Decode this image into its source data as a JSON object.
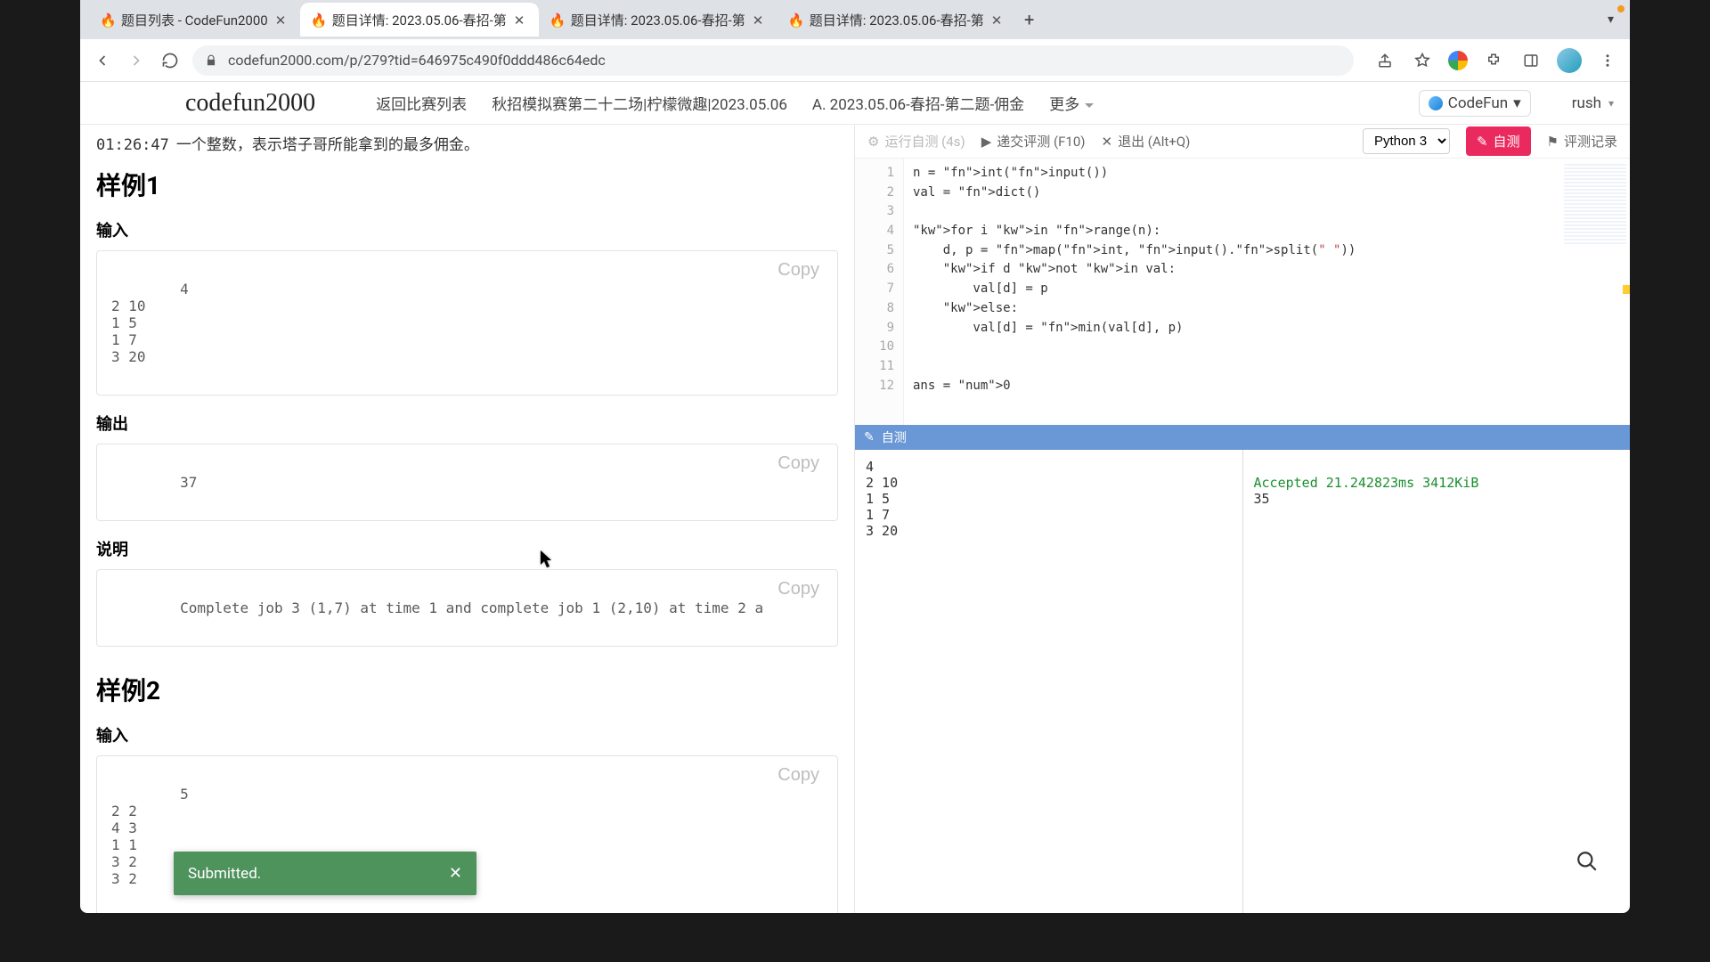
{
  "tabs": [
    {
      "title": "题目列表 - CodeFun2000",
      "active": false
    },
    {
      "title": "题目详情: 2023.05.06-春招-第",
      "active": true
    },
    {
      "title": "题目详情: 2023.05.06-春招-第",
      "active": false
    },
    {
      "title": "题目详情: 2023.05.06-春招-第",
      "active": false
    }
  ],
  "url": "codefun2000.com/p/279?tid=646975c490f0ddd486c64edc",
  "site": {
    "logo": "codefun2000",
    "nav": {
      "back": "返回比赛列表",
      "contest": "秋招模拟赛第二十二场|柠檬微趣|2023.05.06",
      "problem": "A. 2023.05.06-春招-第二题-佣金",
      "more": "更多",
      "codefun": "CodeFun",
      "user": "rush"
    }
  },
  "left": {
    "timer": "01:26:47",
    "desc_frag": "一个整数，表示塔子哥所能拿到的最多佣金。",
    "sample1": "样例1",
    "input_h": "输入",
    "output_h": "输出",
    "explain_h": "说明",
    "sample2": "样例2",
    "copy": "Copy",
    "s1_in": "4\n2 10\n1 5\n1 7\n3 20",
    "s1_out": "37",
    "s1_exp": "Complete job 3 (1,7) at time 1 and complete job 1 (2,10) at time 2 a",
    "s2_in": "5\n2 2\n4 3\n1 1\n3 2\n3 2"
  },
  "rtoolbar": {
    "selftest_run": "运行自测 (4s)",
    "submit": "递交评测 (F10)",
    "exit": "退出 (Alt+Q)",
    "lang": "Python 3",
    "btn": "自测",
    "record": "评测记录"
  },
  "code": {
    "gutter": "1\n2\n3\n4\n5\n6\n7\n8\n9\n10\n11\n12",
    "lines": [
      "n = int(input())",
      "val = dict()",
      "",
      "for i in range(n):",
      "    d, p = map(int, input().split(\" \"))",
      "    if d not in val:",
      "        val[d] = p",
      "    else:",
      "        val[d] = min(val[d], p)",
      "",
      "",
      "ans = 0"
    ]
  },
  "test": {
    "bar": "自测",
    "input": "4\n2 10\n1 5\n1 7\n3 20",
    "status": "Accepted 21.242823ms 3412KiB",
    "answer": "35"
  },
  "toast": "Submitted."
}
